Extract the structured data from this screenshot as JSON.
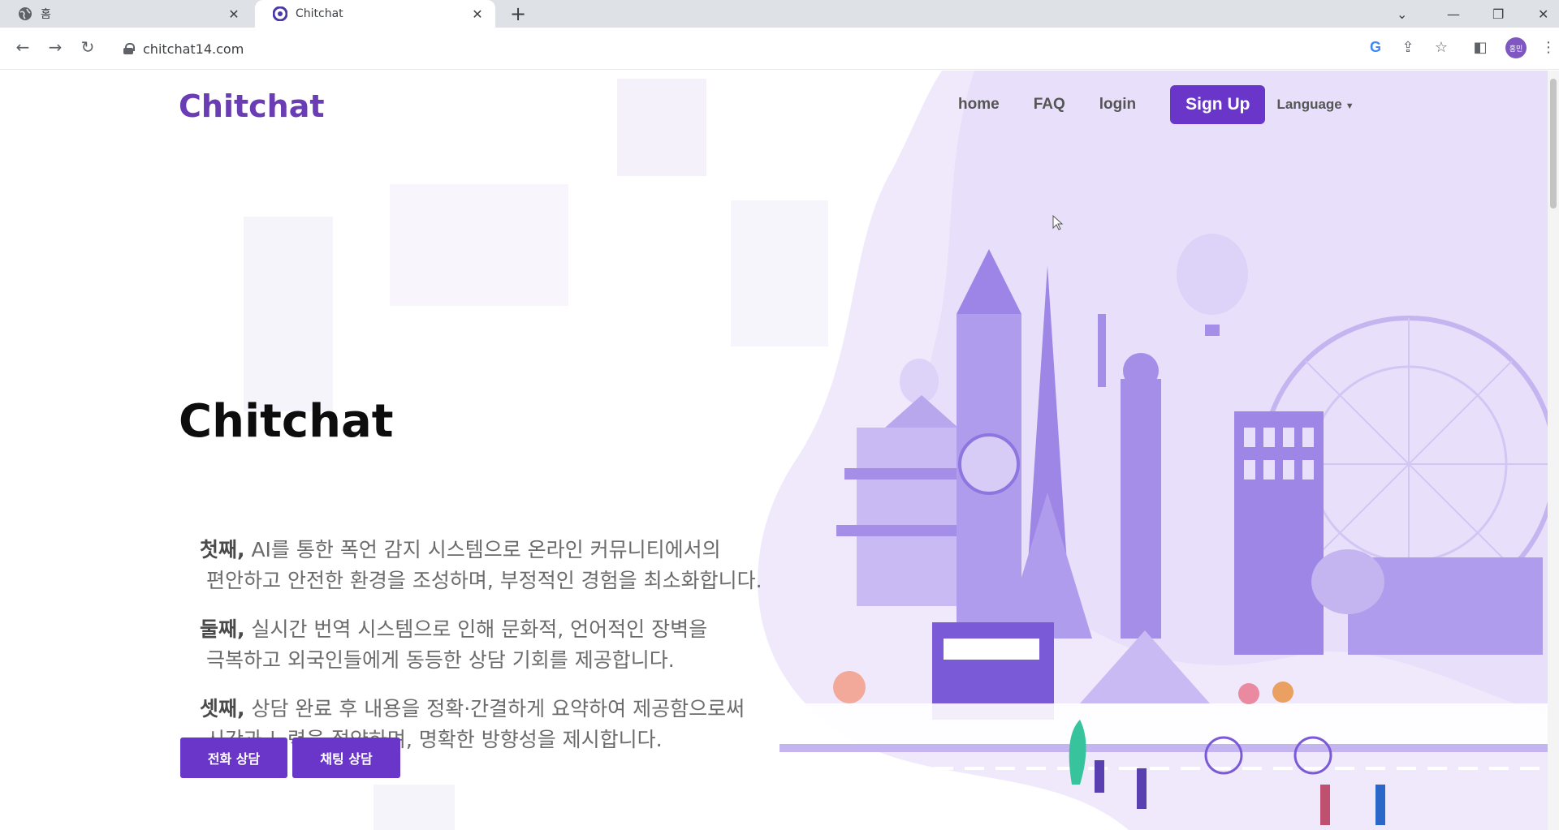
{
  "browser": {
    "tabs": [
      {
        "title": "홈",
        "active": false
      },
      {
        "title": "Chitchat",
        "active": true
      }
    ],
    "url": "chitchat14.com",
    "profile_initials": "홍민"
  },
  "navbar": {
    "logo": "Chitchat",
    "links": [
      "home",
      "FAQ",
      "login"
    ],
    "signup": "Sign Up",
    "language": "Language"
  },
  "hero": {
    "title": "Chitchat",
    "points": [
      {
        "lead": "첫째,",
        "line1": " AI를 통한 폭언 감지 시스템으로 온라인 커뮤니티에서의",
        "line2": "편안하고 안전한 환경을 조성하며, 부정적인 경험을 최소화합니다."
      },
      {
        "lead": "둘째,",
        "line1": " 실시간 번역 시스템으로 인해 문화적, 언어적인 장벽을",
        "line2": "극복하고 외국인들에게 동등한 상담 기회를 제공합니다."
      },
      {
        "lead": "셋째,",
        "line1": " 상담 완료 후 내용을 정확·간결하게 요약하여 제공함으로써",
        "line2": "시간과 노력을 절약하며, 명확한 방향성을 제시합니다."
      }
    ],
    "buttons": [
      "전화 상담",
      "채팅 상담"
    ]
  },
  "colors": {
    "brand": "#6a35c9",
    "logo": "#6a3db5",
    "illustration": "#a48ee8"
  }
}
